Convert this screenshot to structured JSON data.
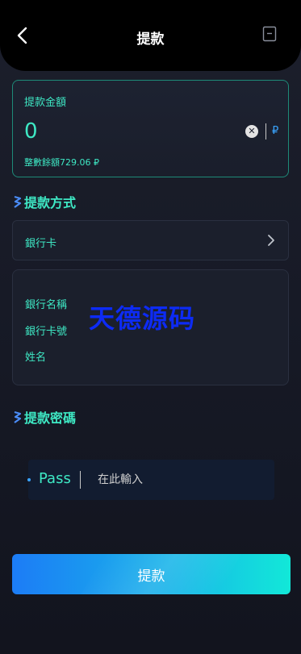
{
  "header": {
    "title": "提款",
    "back_icon": "chevron-left-icon",
    "record_icon": "document-icon"
  },
  "amount": {
    "label": "提款金額",
    "value": "0",
    "currency": "₽",
    "balance_text": "整數餘額729.06 ₽"
  },
  "method_section": {
    "title": "提款方式",
    "selected": "銀行卡"
  },
  "bank_info": {
    "fields": [
      "銀行名稱",
      "銀行卡號",
      "姓名"
    ]
  },
  "watermark": "天德源码",
  "password_section": {
    "title": "提款密碼",
    "label": "Pass",
    "placeholder": "在此輸入"
  },
  "submit": {
    "label": "提款"
  },
  "colors": {
    "accent": "#3ee8c4",
    "header_bg": "#000000",
    "page_bg": "#181b27",
    "button_start": "#1c7cf6",
    "button_end": "#12e8d8",
    "currency": "#3aa5ff"
  }
}
